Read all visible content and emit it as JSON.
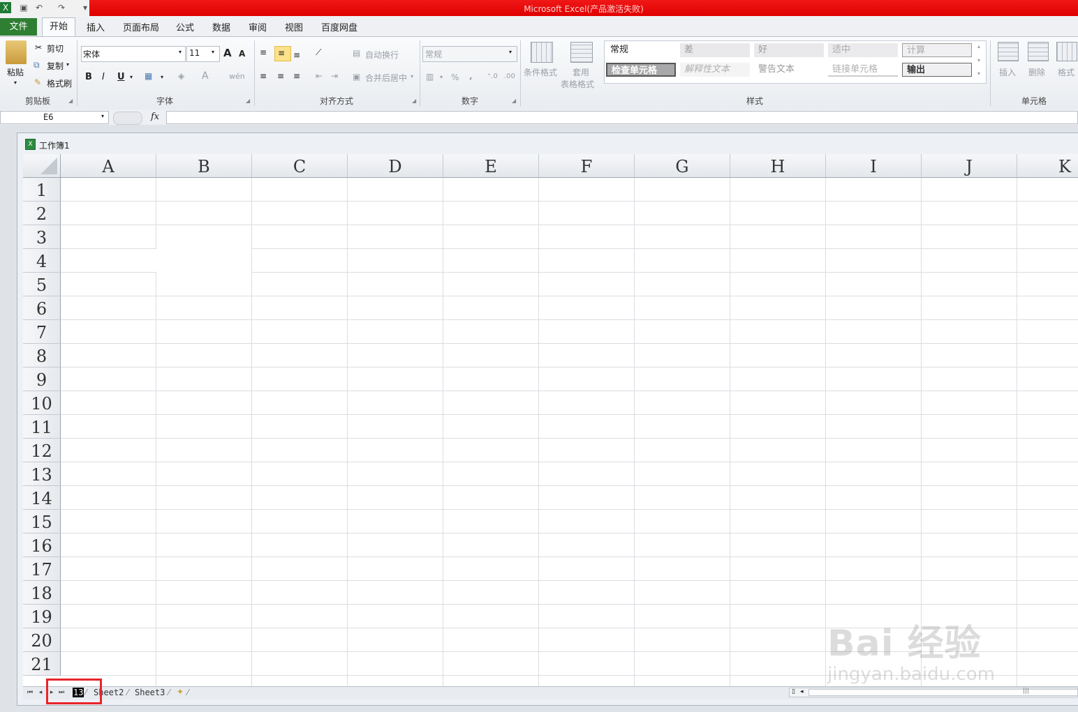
{
  "window": {
    "title": "Microsoft Excel(产品激活失败)"
  },
  "tabs": [
    "文件",
    "开始",
    "插入",
    "页面布局",
    "公式",
    "数据",
    "审阅",
    "视图",
    "百度网盘"
  ],
  "clipboard": {
    "paste": "粘贴",
    "cut": "剪切",
    "copy": "复制",
    "format_painter": "格式刷",
    "label": "剪贴板"
  },
  "font": {
    "name": "宋体",
    "size": "11",
    "label": "字体",
    "bold": "B",
    "italic": "I",
    "underline": "U",
    "grow": "A",
    "shrink": "A",
    "color": "A",
    "wen": "wén"
  },
  "alignment": {
    "wrap": "自动换行",
    "merge": "合并后居中",
    "label": "对齐方式"
  },
  "number": {
    "format": "常规",
    "percent": "%",
    "comma": ",",
    "label": "数字"
  },
  "styles": {
    "cond_format": "条件格式",
    "table_format_1": "套用",
    "table_format_2": "表格格式",
    "label": "样式",
    "row1": [
      "常规",
      "差",
      "好",
      "适中",
      "计算"
    ],
    "row2": [
      "检查单元格",
      "解释性文本",
      "警告文本",
      "链接单元格",
      "输出"
    ]
  },
  "cells": {
    "insert": "插入",
    "delete": "删除",
    "format": "格式",
    "label": "单元格"
  },
  "formula_bar": {
    "name_box": "E6",
    "fx": "fx",
    "value": ""
  },
  "workbook": {
    "title": "工作簿1"
  },
  "columns": [
    "A",
    "B",
    "C",
    "D",
    "E",
    "F",
    "G",
    "H",
    "I",
    "J",
    "K"
  ],
  "rows": [
    "1",
    "2",
    "3",
    "4",
    "5",
    "6",
    "7",
    "8",
    "9",
    "10",
    "11",
    "12",
    "13",
    "14",
    "15",
    "16",
    "17",
    "18",
    "19",
    "20",
    "21"
  ],
  "sheets": [
    "13",
    "Sheet2",
    "Sheet3"
  ],
  "watermark": {
    "main": "Bai 经验",
    "sub": "jingyan.baidu.com"
  },
  "colors": {
    "title_red": "#e80000",
    "file_tab": "#2f7f32",
    "highlight": "#e8242a"
  }
}
